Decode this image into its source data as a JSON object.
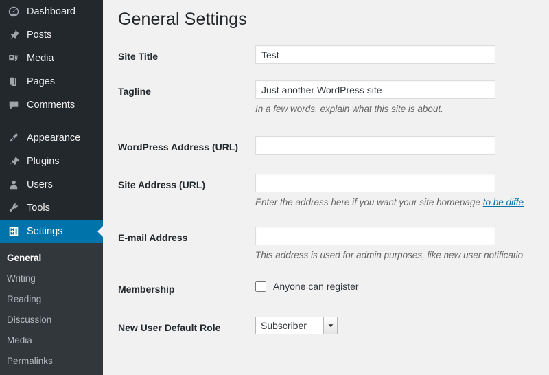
{
  "sidebar": {
    "groups": [
      {
        "items": [
          {
            "label": "Dashboard",
            "icon": "dashboard-icon",
            "current": false
          },
          {
            "label": "Posts",
            "icon": "pushpin-icon",
            "current": false
          },
          {
            "label": "Media",
            "icon": "media-icon",
            "current": false
          },
          {
            "label": "Pages",
            "icon": "pages-icon",
            "current": false
          },
          {
            "label": "Comments",
            "icon": "comment-icon",
            "current": false
          }
        ]
      },
      {
        "items": [
          {
            "label": "Appearance",
            "icon": "paintbrush-icon",
            "current": false
          },
          {
            "label": "Plugins",
            "icon": "plug-icon",
            "current": false
          },
          {
            "label": "Users",
            "icon": "user-icon",
            "current": false
          },
          {
            "label": "Tools",
            "icon": "wrench-icon",
            "current": false
          },
          {
            "label": "Settings",
            "icon": "settings-icon",
            "current": true
          }
        ]
      }
    ],
    "submenu": [
      {
        "label": "General",
        "current": true
      },
      {
        "label": "Writing",
        "current": false
      },
      {
        "label": "Reading",
        "current": false
      },
      {
        "label": "Discussion",
        "current": false
      },
      {
        "label": "Media",
        "current": false
      },
      {
        "label": "Permalinks",
        "current": false
      }
    ],
    "colors": {
      "background": "#23282d",
      "submenu_background": "#32373c",
      "active": "#0073aa"
    }
  },
  "main": {
    "title": "General Settings",
    "fields": {
      "site_title": {
        "label": "Site Title",
        "value": "Test"
      },
      "tagline": {
        "label": "Tagline",
        "value": "Just another WordPress site",
        "description": "In a few words, explain what this site is about."
      },
      "wordpress_address": {
        "label": "WordPress Address (URL)",
        "value": ""
      },
      "site_address": {
        "label": "Site Address (URL)",
        "value": "",
        "description_before": "Enter the address here if you want your site homepage ",
        "description_link": "to be diffe"
      },
      "email_address": {
        "label": "E-mail Address",
        "value": "",
        "description": "This address is used for admin purposes, like new user notificatio"
      },
      "membership": {
        "label": "Membership",
        "checkbox_label": "Anyone can register",
        "checked": false
      },
      "new_user_default_role": {
        "label": "New User Default Role",
        "value": "Subscriber"
      }
    },
    "colors": {
      "background": "#f1f1f1",
      "link": "#0073aa",
      "text": "#23282d"
    }
  }
}
